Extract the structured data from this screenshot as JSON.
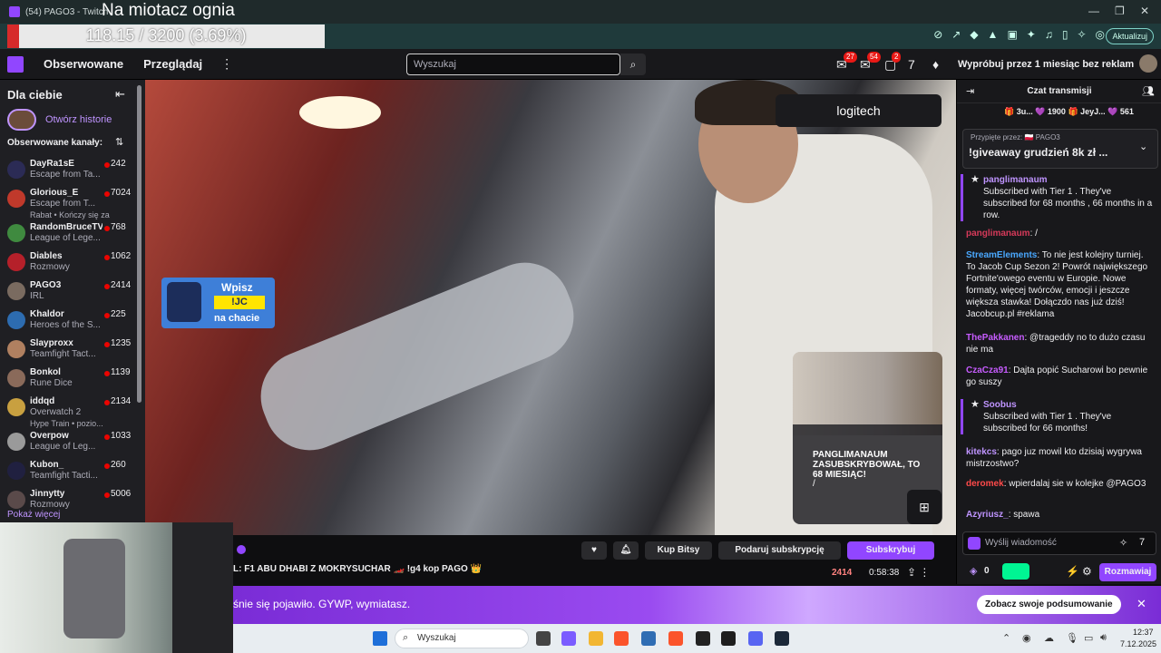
{
  "browser": {
    "tab_title": "(54) PAGO3 - Twitch",
    "overlay_title": "Na miotacz ognia",
    "progress_text": "118.15 / 3200 (3.69%)",
    "progress_fraction": 0.0369,
    "update_label": "Aktualizuj",
    "colors": {
      "progress": "#d62a2a",
      "chrome": "#1f3a3b"
    }
  },
  "topnav": {
    "followed": "Obserwowane",
    "browse": "Przeglądaj",
    "search_placeholder": "Wyszukaj",
    "badge_inbox": "27",
    "badge_notifications": "54",
    "badge_whispers": "2",
    "promo": "Wypróbuj przez 1 miesiąc bez reklam"
  },
  "sidebar": {
    "heading": "Dla ciebie",
    "stories_label": "Otwórz historie",
    "followed_heading": "Obserwowane kanały:",
    "show_more": "Pokaż więcej",
    "channels": [
      {
        "name": "DayRa1sE",
        "game": "Escape from Ta...",
        "viewers": "242",
        "color": "#2b2b55"
      },
      {
        "name": "Glorious_E",
        "game": "Escape from T...",
        "viewers": "7024",
        "extra": "Rabat • Kończy się za",
        "color": "#c0392b"
      },
      {
        "name": "RandomBruceTV",
        "game": "League of Lege...",
        "viewers": "768",
        "color": "#3f8a3f"
      },
      {
        "name": "Diables",
        "game": "Rozmowy",
        "viewers": "1062",
        "color": "#b5202a"
      },
      {
        "name": "PAGO3",
        "game": "IRL",
        "viewers": "2414",
        "color": "#7a6b60"
      },
      {
        "name": "Khaldor",
        "game": "Heroes of the S...",
        "viewers": "225",
        "color": "#2d6cb0"
      },
      {
        "name": "Slayproxx",
        "game": "Teamfight Tact...",
        "viewers": "1235",
        "color": "#b08060"
      },
      {
        "name": "Bonkol",
        "game": "Rune Dice",
        "viewers": "1139",
        "color": "#8a6a5a"
      },
      {
        "name": "iddqd",
        "game": "Overwatch 2",
        "viewers": "2134",
        "extra": "Hype Train • pozio...",
        "color": "#c8a040"
      },
      {
        "name": "Overpow",
        "game": "League of Leg...",
        "viewers": "1033",
        "color": "#9a9a9a"
      },
      {
        "name": "Kubon_",
        "game": "Teamfight Tacti...",
        "viewers": "260",
        "color": "#202040"
      },
      {
        "name": "Jinnytty",
        "game": "Rozmowy",
        "viewers": "5006",
        "color": "#5a4a4a"
      }
    ]
  },
  "video": {
    "logitech": "logitech",
    "jc_line1": "Wpisz",
    "jc_line2": "!JC",
    "jc_line3": "na chacie",
    "cam_alert": "PANGLIMANAUM ZASUBSKRYBOWAŁ, TO 68 MIESIĄC!",
    "cam_slash": "/"
  },
  "info": {
    "title": "L: F1 ABU DHABI Z MOKRYSUCHAR 🏎️ !g4 kop PAGO 👑",
    "buttons": {
      "bits": "Kup Bitsy",
      "gift": "Podaruj subskrypcję",
      "subscribe": "Subskrybuj"
    },
    "viewers": "2414",
    "uptime": "0:58:38"
  },
  "banner": {
    "text": "śnie się pojawiło. GYWP, wymiatasz.",
    "button": "Zobacz swoje podsumowanie"
  },
  "chat": {
    "title": "Czat transmisji",
    "leaders": "🎁 3u...  💜 1900   🎁 JeyJ...  💜 561",
    "pinned_by": "Przypięte przez: 🇵🇱 PAGO3",
    "pinned_msg": "!giveaway grudzień 8k zł ...",
    "sub1_user": "panglimanaum",
    "sub1_text": "Subscribed with Tier 1 . They've subscribed for 68 months , 66 months in a row.",
    "m_pang_user": "panglimanaum",
    "m_pang_text": ": /",
    "se_user": "StreamElements",
    "se_text": ": To nie jest kolejny turniej. To Jacob Cup Sezon 2! Powrót największego Fortnite'owego eventu w Europie. Nowe formaty, więcej twórców, emocji i jeszcze większa stawka! Dołączdo nas już dziś! Jacobcup.pl #reklama",
    "pak_user": "ThePakkanen",
    "pak_text": ": @trageddy no to dużo czasu nie ma",
    "cza_user": "CzaCza91",
    "cza_text": ": Dajta popić Sucharowi bo pewnie go suszy",
    "sub2_user": "Soobus",
    "sub2_text": "Subscribed with Tier 1 . They've subscribed for 66 months!",
    "kit_user": "kitekcs",
    "kit_text": ": pago juz mowil kto dzisiaj wygrywa mistrzostwo?",
    "der_user": "deromek",
    "der_text": ": wpierdalaj sie w kolejke @PAGO3",
    "azy_user": "Azyriusz_",
    "azy_text": ": spawa",
    "input_placeholder": "Wyślij wiadomość",
    "points": "0",
    "chat_button": "Rozmawiaj"
  },
  "taskbar": {
    "search": "Wyszukaj",
    "time": "12:37",
    "date": "7.12.2025"
  }
}
